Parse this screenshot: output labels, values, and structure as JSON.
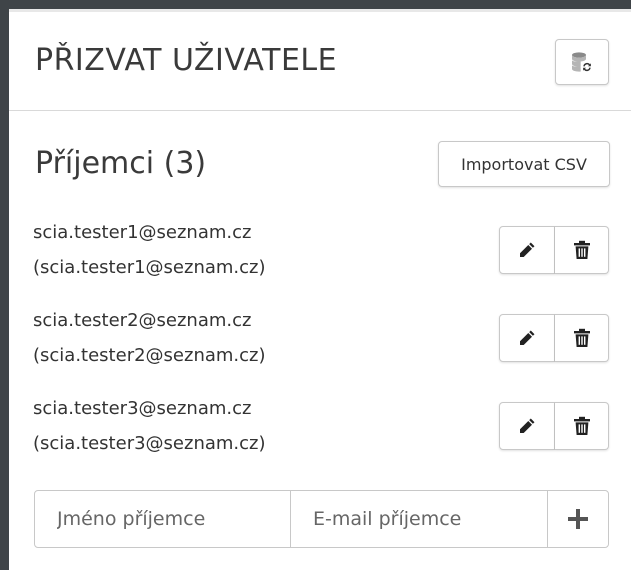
{
  "header": {
    "title": "PŘIZVAT UŽIVATELE",
    "refresh_icon": "database-refresh-icon"
  },
  "recipients_section": {
    "title": "Příjemci (3)",
    "import_label": "Importovat CSV"
  },
  "recipients": [
    {
      "name": "scia.tester1@seznam.cz",
      "email": "(scia.tester1@seznam.cz)"
    },
    {
      "name": "scia.tester2@seznam.cz",
      "email": "(scia.tester2@seznam.cz)"
    },
    {
      "name": "scia.tester3@seznam.cz",
      "email": "(scia.tester3@seznam.cz)"
    }
  ],
  "row_actions": {
    "edit_icon": "pencil-icon",
    "delete_icon": "trash-icon"
  },
  "add_form": {
    "name_placeholder": "Jméno příjemce",
    "email_placeholder": "E-mail příjemce",
    "add_icon": "plus-icon"
  },
  "colors": {
    "frame": "#3f4448",
    "border": "#c8c8c8",
    "text": "#333333"
  }
}
